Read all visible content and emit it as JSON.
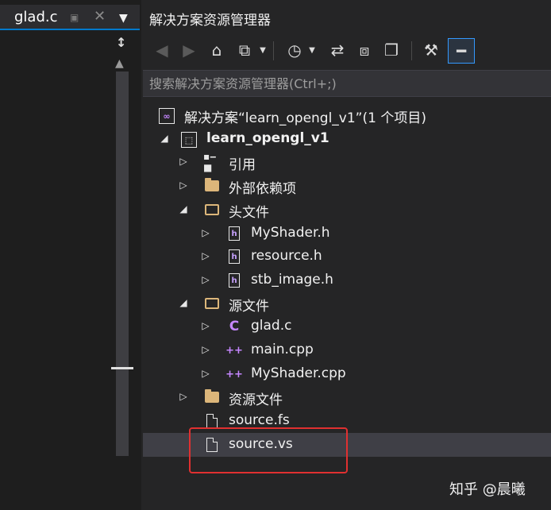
{
  "document_tab": {
    "title": "glad.c",
    "pin_icon": "pin-icon",
    "close_icon": "close-icon",
    "dropdown_icon": "chevron-down-icon"
  },
  "explorer": {
    "title": "解决方案资源管理器",
    "toolbar": [
      {
        "name": "back-icon",
        "glyph": "◀",
        "enabled": false
      },
      {
        "name": "forward-icon",
        "glyph": "▶",
        "enabled": false
      },
      {
        "name": "home-icon",
        "glyph": "⌂",
        "enabled": true
      },
      {
        "name": "switch-views-icon",
        "glyph": "⧉",
        "enabled": true
      },
      {
        "name": "pending-changes-filter-icon",
        "glyph": "◷",
        "enabled": true
      },
      {
        "name": "sync-icon",
        "glyph": "⇄",
        "enabled": true
      },
      {
        "name": "collapse-all-icon",
        "glyph": "⧈",
        "enabled": true
      },
      {
        "name": "show-all-files-icon",
        "glyph": "❐",
        "enabled": true
      },
      {
        "name": "properties-wrench-icon",
        "glyph": "⚒",
        "enabled": true
      },
      {
        "name": "preview-selected-icon",
        "glyph": "−",
        "enabled": true
      }
    ],
    "search_placeholder": "搜索解决方案资源管理器(Ctrl+;)"
  },
  "tree": {
    "solution_label": "解决方案“learn_opengl_v1”(1 个项目)",
    "project_label": "learn_opengl_v1",
    "references_label": "引用",
    "external_deps_label": "外部依赖项",
    "header_files_label": "头文件",
    "header_files": [
      "MyShader.h",
      "resource.h",
      "stb_image.h"
    ],
    "source_files_label": "源文件",
    "source_files": [
      "glad.c",
      "main.cpp",
      "MyShader.cpp"
    ],
    "resource_files_label": "资源文件",
    "loose_files": [
      "source.fs",
      "source.vs"
    ]
  },
  "watermark": "知乎 @晨曦",
  "colors": {
    "accent": "#007acc",
    "highlight_box": "#e03030",
    "folder": "#dcb67a",
    "cpp": "#c586ff",
    "background": "#252526"
  }
}
